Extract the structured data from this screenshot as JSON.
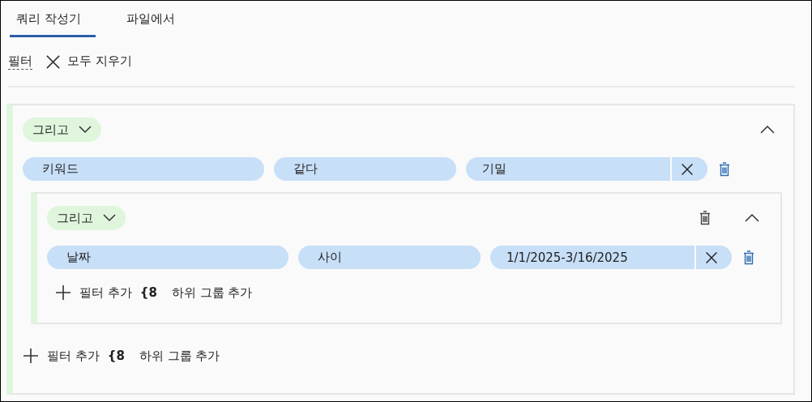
{
  "tabs": [
    {
      "label": "쿼리 작성기",
      "selected": true
    },
    {
      "label": "파일에서",
      "selected": false
    }
  ],
  "toolbar": {
    "filter_label": "필터",
    "clear_all": "모두 지우기"
  },
  "group": {
    "operator": "그리고",
    "expanded": true,
    "conditions": [
      {
        "field": "키워드",
        "operator": "같다",
        "value": "기밀"
      }
    ],
    "subgroups": [
      {
        "operator": "그리고",
        "expanded": true,
        "conditions": [
          {
            "field": "날짜",
            "operator": "사이",
            "value": "1/1/2025-3/16/2025"
          }
        ],
        "add_filter": "필터 추가",
        "subgroup_mark": "{8",
        "add_subgroup": "하위 그룹 추가"
      }
    ],
    "add_filter": "필터 추가",
    "subgroup_mark": "{8",
    "add_subgroup": "하위 그룹 추가"
  }
}
